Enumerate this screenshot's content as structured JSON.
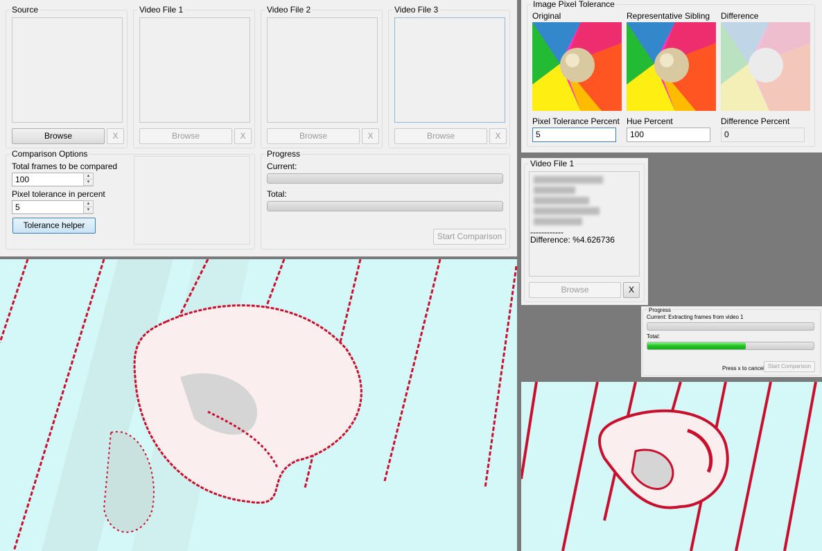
{
  "main_form": {
    "source": {
      "title": "Source",
      "browse": "Browse",
      "close": "X"
    },
    "video1": {
      "title": "Video File 1",
      "browse": "Browse",
      "close": "X"
    },
    "video2": {
      "title": "Video File 2",
      "browse": "Browse",
      "close": "X"
    },
    "video3": {
      "title": "Video File 3",
      "browse": "Browse",
      "close": "X"
    },
    "options": {
      "title": "Comparison Options",
      "frames_label": "Total frames to be compared",
      "frames_value": "100",
      "tolerance_label": "Pixel tolerance in percent",
      "tolerance_value": "5",
      "helper_button": "Tolerance helper"
    },
    "progress": {
      "title": "Progress",
      "current_label": "Current:",
      "total_label": "Total:",
      "start_button": "Start Comparison",
      "current_fraction": 0,
      "total_fraction": 0
    }
  },
  "tolerance_window": {
    "title": "Image Pixel Tolerance",
    "original_label": "Original",
    "sibling_label": "Representative Sibling",
    "difference_label": "Difference",
    "pixel_tolerance_label": "Pixel Tolerance Percent",
    "pixel_tolerance_value": "5",
    "hue_label": "Hue Percent",
    "hue_value": "100",
    "difference_percent_label": "Difference Percent",
    "difference_percent_value": "0"
  },
  "video_panel": {
    "title": "Video File 1",
    "separator": "------------",
    "difference_text": "Difference: %4.626736",
    "browse": "Browse",
    "close": "X"
  },
  "progress_panel": {
    "title": "Progress",
    "current_text": "Current: Extracting frames from video 1",
    "total_label": "Total:",
    "cancel_hint": "Press x to cancel",
    "start_button": "Start Comparison",
    "current_fraction": 0,
    "total_fraction": 0.59
  },
  "colors": {
    "accent_blue": "#3c7fb1",
    "progress_green": "#22c322",
    "diff_red": "#c8102e",
    "diff_bg": "#d4f8f8"
  }
}
